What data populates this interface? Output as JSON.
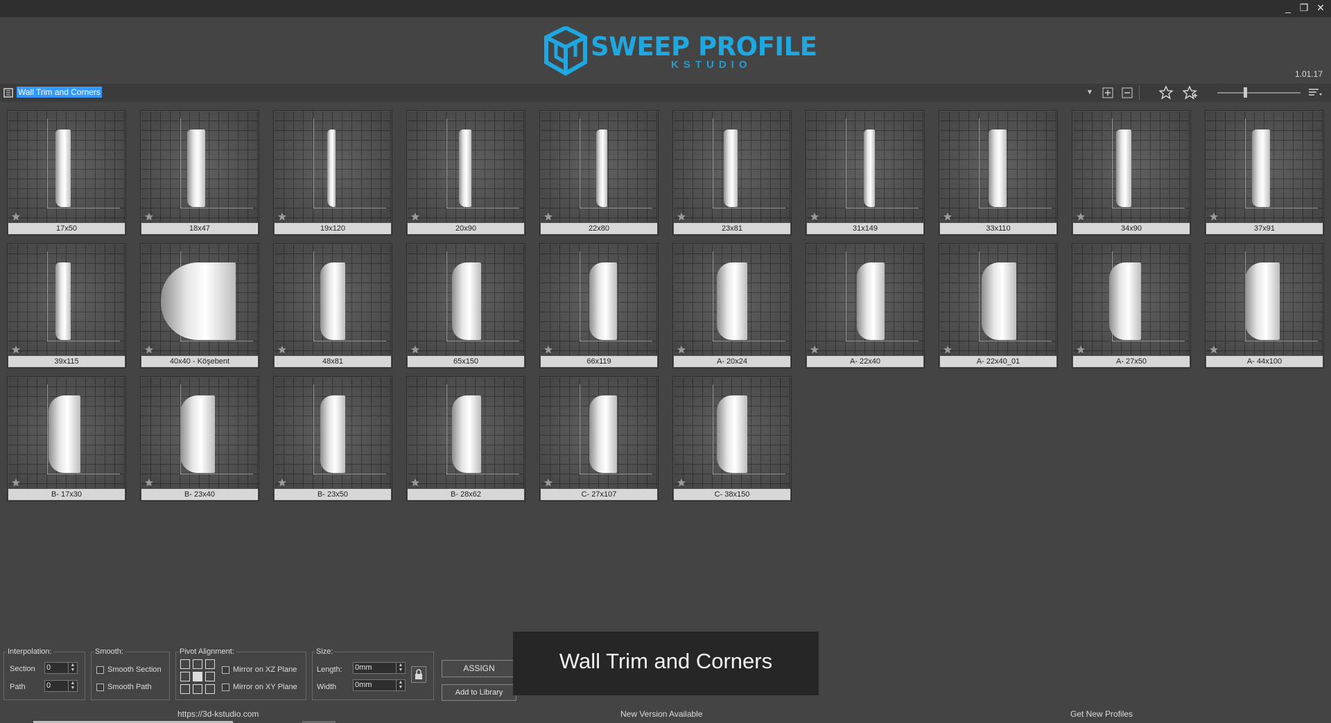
{
  "window": {
    "controls": [
      "_",
      "❐",
      "✕"
    ]
  },
  "logo": {
    "name": "SWEEP PROFILE",
    "sub": "KSTUDIO"
  },
  "version": "1.01.17",
  "library": {
    "name": "Wall Trim and Corners"
  },
  "toolbar_icons": [
    "expand-icon",
    "collapse-icon",
    "star-icon",
    "star-add-icon",
    "sort-icon"
  ],
  "profiles": [
    "17x50",
    "18x47",
    "19x120",
    "20x90",
    "22x80",
    "23x81",
    "31x149",
    "33x110",
    "34x90",
    "37x91",
    "39x115",
    "40x40 - Köşebent",
    "48x81",
    "65x150",
    "66x119",
    "A- 20x24",
    "A- 22x40",
    "A- 22x40_01",
    "A- 27x50",
    "A- 44x100",
    "B- 17x30",
    "B- 23x40",
    "B- 23x50",
    "B- 28x62",
    "C- 27x107",
    "C- 38x150"
  ],
  "controls": {
    "interpolation": {
      "title": "Interpolation:",
      "section_label": "Section",
      "section_value": "0",
      "path_label": "Path",
      "path_value": "0"
    },
    "smooth": {
      "title": "Smooth:",
      "section": "Smooth Section",
      "path": "Smooth Path"
    },
    "pivot": {
      "title": "Pivot Alignment:",
      "mirror_xz": "Mirror on XZ Plane",
      "mirror_xy": "Mirror on XY Plane"
    },
    "size": {
      "title": "Size:",
      "length_label": "Length:",
      "length_value": "0mm",
      "width_label": "Width",
      "width_value": "0mm"
    },
    "assign": "ASSIGN",
    "add_library": "Add to Library"
  },
  "toast": "Wall Trim and Corners",
  "status": {
    "url": "https://3d-kstudio.com",
    "update": "New Version Available",
    "get": "Get New Profiles"
  }
}
